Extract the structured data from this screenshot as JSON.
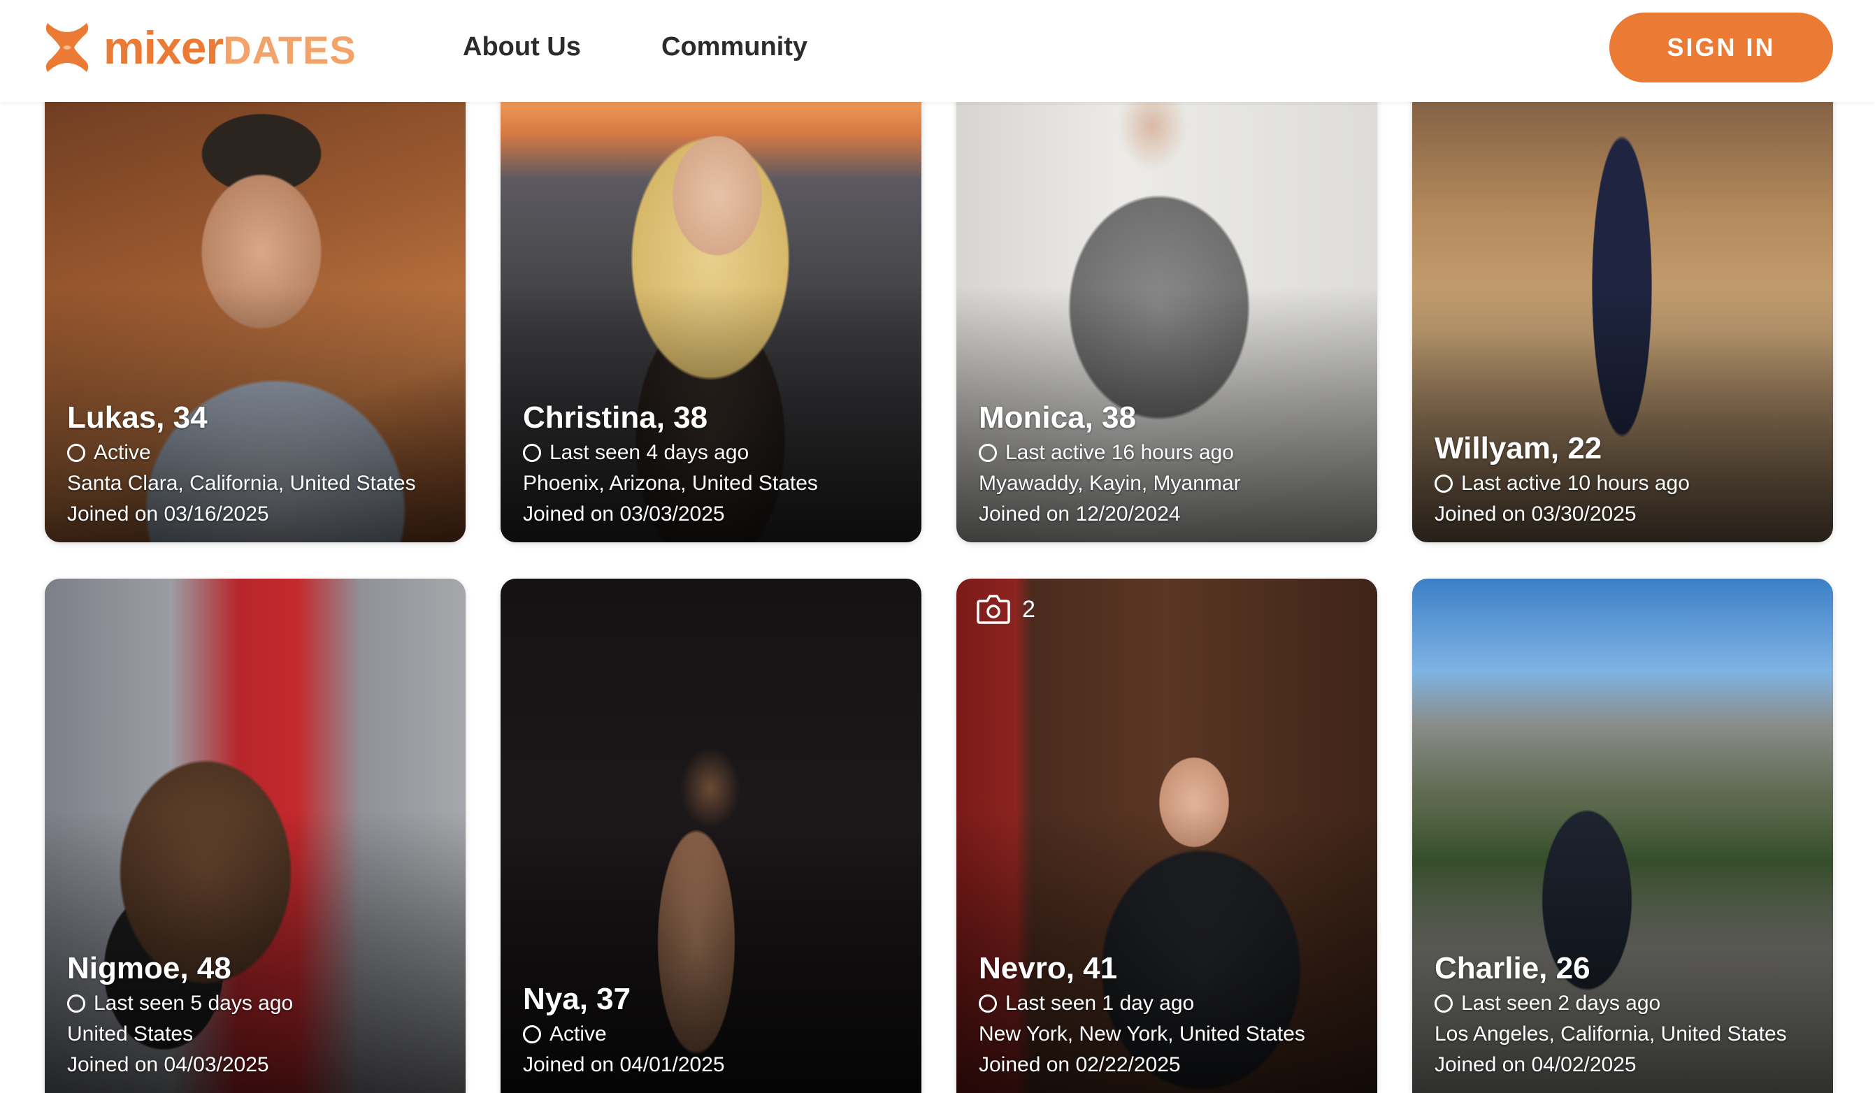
{
  "header": {
    "logo_main": "mixer",
    "logo_sub": "DATES",
    "nav": [
      "About Us",
      "Community"
    ],
    "signin_label": "SIGN IN"
  },
  "colors": {
    "accent": "#ea7a34",
    "accent_light": "#f3a36a"
  },
  "profiles": [
    {
      "name": "Lukas, 34",
      "status": "Active",
      "location": "Santa Clara, California, United States",
      "joined": "Joined on 03/16/2025"
    },
    {
      "name": "Christina, 38",
      "status": "Last seen 4 days ago",
      "location": "Phoenix, Arizona, United States",
      "joined": "Joined on 03/03/2025"
    },
    {
      "name": "Monica, 38",
      "status": "Last active 16 hours ago",
      "location": "Myawaddy, Kayin, Myanmar",
      "joined": "Joined on 12/20/2024"
    },
    {
      "name": "Willyam, 22",
      "status": "Last active 10 hours ago",
      "joined": "Joined on 03/30/2025"
    },
    {
      "name": "Nigmoe, 48",
      "status": "Last seen 5 days ago",
      "location": "United States",
      "joined": "Joined on 04/03/2025"
    },
    {
      "name": "Nya, 37",
      "status": "Active",
      "joined": "Joined on 04/01/2025"
    },
    {
      "name": "Nevro, 41",
      "status": "Last seen 1 day ago",
      "location": "New York, New York, United States",
      "joined": "Joined on 02/22/2025",
      "photo_count": "2"
    },
    {
      "name": "Charlie, 26",
      "status": "Last seen 2 days ago",
      "location": "Los Angeles, California, United States",
      "joined": "Joined on 04/02/2025"
    }
  ]
}
